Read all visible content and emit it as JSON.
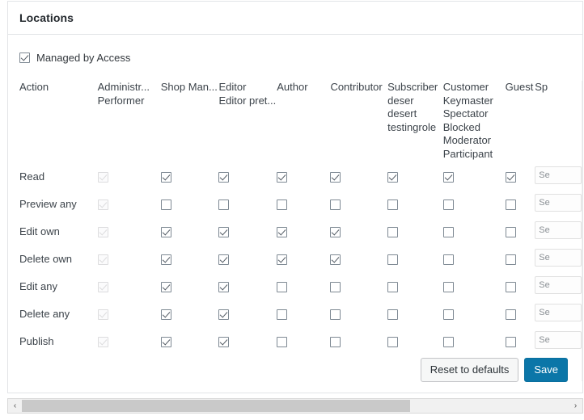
{
  "card": {
    "title": "Locations"
  },
  "managed": {
    "label": "Managed by Access",
    "checked": true
  },
  "table": {
    "action_header": "Action",
    "columns": [
      {
        "name": "Administr...",
        "sub": [
          "Performer"
        ],
        "disabled": true
      },
      {
        "name": "Shop Man...",
        "sub": [],
        "disabled": false
      },
      {
        "name": "Editor",
        "sub": [
          "Editor pret..."
        ],
        "disabled": false
      },
      {
        "name": "Author",
        "sub": [],
        "disabled": false
      },
      {
        "name": "Contributor",
        "sub": [],
        "disabled": false
      },
      {
        "name": "Subscriber",
        "sub": [
          "deser",
          "desert",
          "testingrole"
        ],
        "disabled": false
      },
      {
        "name": "Customer",
        "sub": [
          "Keymaster",
          "Spectator",
          "Blocked",
          "Moderator",
          "Participant"
        ],
        "disabled": false
      },
      {
        "name": "Guest",
        "sub": [],
        "disabled": false
      },
      {
        "name": "Sp",
        "sub": [],
        "disabled": false
      }
    ],
    "rows": [
      {
        "action": "Read",
        "values": [
          true,
          true,
          true,
          true,
          true,
          true,
          true,
          true
        ],
        "select": "Se"
      },
      {
        "action": "Preview any",
        "values": [
          true,
          false,
          false,
          false,
          false,
          false,
          false,
          false
        ],
        "select": "Se"
      },
      {
        "action": "Edit own",
        "values": [
          true,
          true,
          true,
          true,
          true,
          false,
          false,
          false
        ],
        "select": "Se"
      },
      {
        "action": "Delete own",
        "values": [
          true,
          true,
          true,
          true,
          true,
          false,
          false,
          false
        ],
        "select": "Se"
      },
      {
        "action": "Edit any",
        "values": [
          true,
          true,
          true,
          false,
          false,
          false,
          false,
          false
        ],
        "select": "Se"
      },
      {
        "action": "Delete any",
        "values": [
          true,
          true,
          true,
          false,
          false,
          false,
          false,
          false
        ],
        "select": "Se"
      },
      {
        "action": "Publish",
        "values": [
          true,
          true,
          true,
          false,
          false,
          false,
          false,
          false
        ],
        "select": "Se"
      }
    ]
  },
  "footer": {
    "reset_label": "Reset to defaults",
    "save_label": "Save"
  },
  "scrollbar": {
    "left_arrow": "‹",
    "right_arrow": "›",
    "thumb_percent": 71
  },
  "colors": {
    "primary": "#0b76a8",
    "border": "#e2e4e7",
    "text": "#32373c"
  }
}
